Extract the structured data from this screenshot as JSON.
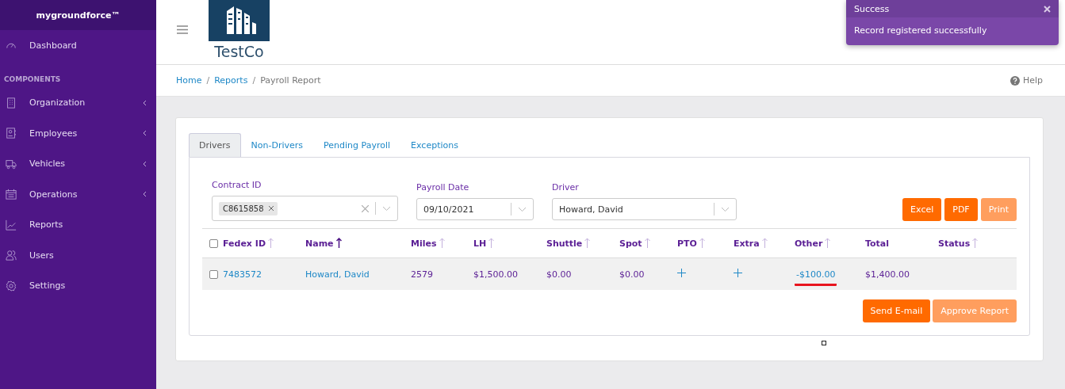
{
  "sidebar": {
    "brand": "mygroundforce™",
    "items": [
      {
        "label": "Dashboard",
        "expandable": false
      }
    ],
    "section": "COMPONENTS",
    "groups": [
      {
        "label": "Organization",
        "expandable": true
      },
      {
        "label": "Employees",
        "expandable": true
      },
      {
        "label": "Vehicles",
        "expandable": true
      },
      {
        "label": "Operations",
        "expandable": true
      },
      {
        "label": "Reports",
        "expandable": false
      },
      {
        "label": "Users",
        "expandable": false
      },
      {
        "label": "Settings",
        "expandable": false
      }
    ]
  },
  "header": {
    "logo_text": "TestCo"
  },
  "breadcrumb": {
    "items": [
      "Home",
      "Reports",
      "Payroll Report"
    ],
    "separators": [
      "/",
      "/"
    ],
    "help": "Help"
  },
  "tabs": [
    {
      "label": "Drivers",
      "selected": true
    },
    {
      "label": "Non-Drivers",
      "selected": false
    },
    {
      "label": "Pending Payroll",
      "selected": false
    },
    {
      "label": "Exceptions",
      "selected": false
    }
  ],
  "filters": {
    "contract_id": {
      "label": "Contract ID",
      "tags": [
        "C8615858"
      ]
    },
    "payroll_date": {
      "label": "Payroll Date",
      "value": "09/10/2021"
    },
    "driver": {
      "label": "Driver",
      "value": "Howard, David"
    }
  },
  "export_buttons": [
    {
      "label": "Excel",
      "disabled": false
    },
    {
      "label": "PDF",
      "disabled": false
    },
    {
      "label": "Print",
      "disabled": true
    }
  ],
  "table": {
    "all_checked": false,
    "columns": [
      {
        "label": "Fedex ID",
        "sortable": true,
        "sorted": false
      },
      {
        "label": "Name",
        "sortable": true,
        "sorted": true
      },
      {
        "label": "Miles",
        "sortable": true,
        "sorted": false
      },
      {
        "label": "LH",
        "sortable": true,
        "sorted": false
      },
      {
        "label": "Shuttle",
        "sortable": true,
        "sorted": false
      },
      {
        "label": "Spot",
        "sortable": true,
        "sorted": false
      },
      {
        "label": "PTO",
        "sortable": true,
        "sorted": false
      },
      {
        "label": "Extra",
        "sortable": true,
        "sorted": false
      },
      {
        "label": "Other",
        "sortable": true,
        "sorted": false
      },
      {
        "label": "Total",
        "sortable": false
      },
      {
        "label": "Status",
        "sortable": true,
        "sorted": false
      }
    ],
    "rows": [
      {
        "checked": false,
        "cells": [
          {
            "kind": "link",
            "text": "7483572"
          },
          {
            "kind": "link",
            "text": "Howard, David"
          },
          {
            "kind": "text",
            "text": "2579"
          },
          {
            "kind": "text",
            "text": "$1,500.00"
          },
          {
            "kind": "text",
            "text": "$0.00"
          },
          {
            "kind": "text",
            "text": "$0.00"
          },
          {
            "kind": "add"
          },
          {
            "kind": "add"
          },
          {
            "kind": "link",
            "text": "-$100.00",
            "underlined": true
          },
          {
            "kind": "text",
            "text": "$1,400.00"
          },
          {
            "kind": "empty"
          }
        ]
      }
    ]
  },
  "actions": [
    {
      "label": "Send E-mail",
      "disabled": false
    },
    {
      "label": "Approve Report",
      "disabled": true
    }
  ],
  "toast": {
    "title": "Success",
    "message": "Record registered successfully"
  }
}
